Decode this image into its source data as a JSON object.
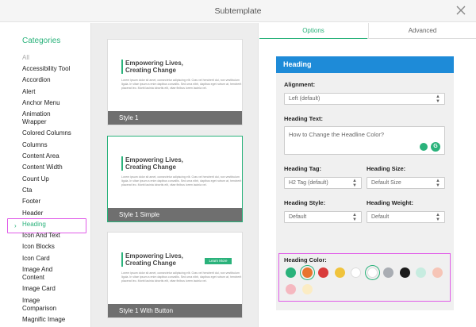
{
  "dialog": {
    "title": "Subtemplate"
  },
  "categories": {
    "heading": "Categories",
    "items": [
      "All",
      "Accessibility Tool",
      "Accordion",
      "Alert",
      "Anchor Menu",
      "Animation\nWrapper",
      "Colored Columns",
      "Columns",
      "Content Area",
      "Content Width",
      "Count Up",
      "Cta",
      "Footer",
      "Header",
      "Heading",
      "Icon And Text",
      "Icon Blocks",
      "Icon Card",
      "Image And\nContent",
      "Image Card",
      "Image\nComparison",
      "Magnific Image"
    ],
    "active": "Heading"
  },
  "thumbnails": [
    {
      "label": "Style 1",
      "heading": "Empowering Lives,\nCreating Change",
      "body": "Lorem ipsum dolor sit amet, consectetur adipiscing elit. Cras vel hendrerit dui, non vestibulum ligula. In vitae ipsum a enim dapibus convallis. Sed urna nibh, dapibus eget rutrum at, hendrerit placerat leo. Morbi lacinia lobortis elit, vitae finibus lorem lacinia vel."
    },
    {
      "label": "Style 1 Simple",
      "heading": "Empowering Lives,\nCreating Change",
      "body": "Lorem ipsum dolor sit amet, consectetur adipiscing elit. Cras vel hendrerit dui, non vestibulum ligula. In vitae ipsum a enim dapibus convallis. Sed urna nibh, dapibus eget rutrum at, hendrerit placerat leo. Morbi lacinia lobortis elit, vitae finibus lorem lacinia vel."
    },
    {
      "label": "Style 1 With Button",
      "heading": "Empowering Lives,\nCreating Change",
      "button": "Learn More",
      "body": "Lorem ipsum dolor sit amet, consectetur adipiscing elit. Cras vel hendrerit dui, non vestibulum ligula. In vitae ipsum a enim dapibus convallis. Sed urna nibh, dapibus eget rutrum at, hendrerit placerat leo. Morbi lacinia lobortis elit, vitae finibus lorem lacinia vel."
    }
  ],
  "tabs": [
    "Options",
    "Advanced"
  ],
  "heading_section": {
    "title": "Heading",
    "alignment_label": "Alignment:",
    "alignment_value": "Left (default)",
    "text_label": "Heading Text:",
    "text_value": "How to Change the Headline Color?",
    "tag_label": "Heading Tag:",
    "tag_value": "H2 Tag (default)",
    "size_label": "Heading Size:",
    "size_value": "Default Size",
    "style_label": "Heading Style:",
    "style_value": "Default",
    "weight_label": "Heading Weight:",
    "weight_value": "Default",
    "color_label": "Heading Color:",
    "colors": [
      "#2ab27b",
      "#e8742e",
      "#d93b3b",
      "#f0c33c",
      "#ffffff",
      "#ffffff",
      "#a9adb3",
      "#1b1b1b",
      "#c7ece0",
      "#f6c5b7",
      "#f5b8c0",
      "#fbecc4"
    ],
    "selected_colors": [
      1,
      5
    ]
  }
}
